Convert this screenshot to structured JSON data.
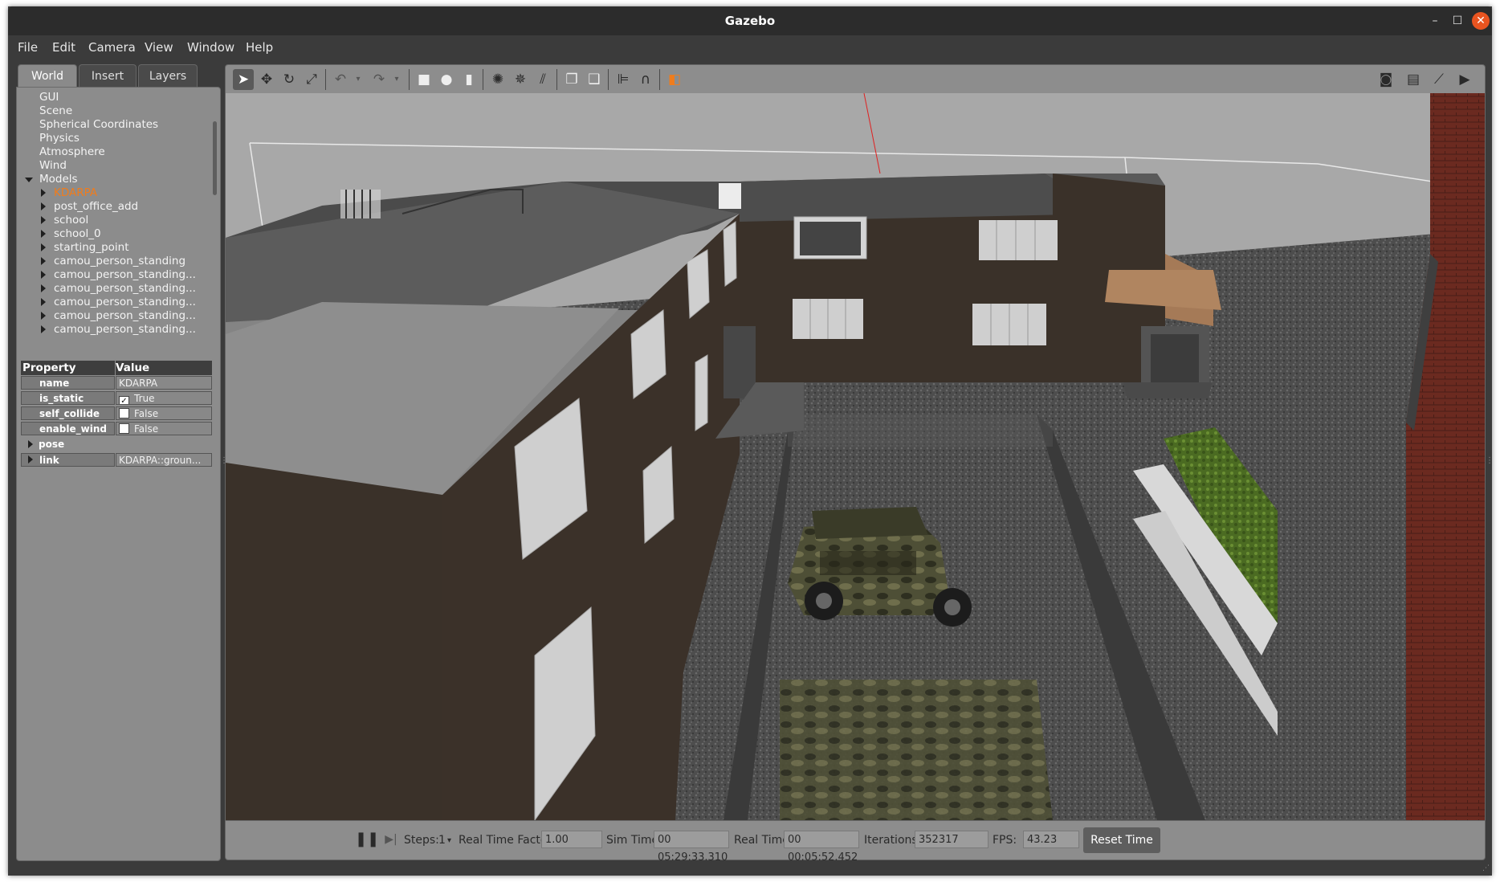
{
  "window": {
    "title": "Gazebo"
  },
  "menubar": [
    "File",
    "Edit",
    "Camera",
    "View",
    "Window",
    "Help"
  ],
  "left_tabs": [
    "World",
    "Insert",
    "Layers"
  ],
  "tree": {
    "top_items": [
      "GUI",
      "Scene",
      "Spherical Coordinates",
      "Physics",
      "Atmosphere",
      "Wind"
    ],
    "models_label": "Models",
    "models": [
      "KDARPA",
      "post_office_add",
      "school",
      "school_0",
      "starting_point",
      "camou_person_standing",
      "camou_person_standing...",
      "camou_person_standing...",
      "camou_person_standing...",
      "camou_person_standing...",
      "camou_person_standing..."
    ],
    "selected_color": "#f07c1c"
  },
  "properties": {
    "header_property": "Property",
    "header_value": "Value",
    "rows": [
      {
        "key": "name",
        "value": "KDARPA"
      },
      {
        "key": "is_static",
        "value": "True",
        "checked": true
      },
      {
        "key": "self_collide",
        "value": "False",
        "checked": false
      },
      {
        "key": "enable_wind",
        "value": "False",
        "checked": false
      },
      {
        "key": "pose",
        "value": ""
      },
      {
        "key": "link",
        "value": "KDARPA::groun..."
      }
    ]
  },
  "toolbar": {
    "icons": [
      "select-mode-icon",
      "translate-mode-icon",
      "rotate-mode-icon",
      "scale-mode-icon",
      "undo-icon",
      "redo-icon",
      "box-shape-icon",
      "sphere-shape-icon",
      "cylinder-shape-icon",
      "point-light-icon",
      "spot-light-icon",
      "directional-light-icon",
      "copy-icon",
      "paste-icon",
      "align-icon",
      "snap-icon",
      "change-view-icon",
      "screenshot-icon",
      "logging-icon",
      "plot-icon",
      "video-record-icon"
    ]
  },
  "bottom": {
    "steps_label": "Steps:",
    "steps_value": "1",
    "rtf_label": "Real Time Factor:",
    "rtf_value": "1.00",
    "sim_time_label": "Sim Time:",
    "sim_time_value": "00 05:29:33.310",
    "real_time_label": "Real Time:",
    "real_time_value": "00 00:05:52.452",
    "iterations_label": "Iterations:",
    "iterations_value": "352317",
    "fps_label": "FPS:",
    "fps_value": "43.23",
    "reset_label": "Reset Time"
  }
}
